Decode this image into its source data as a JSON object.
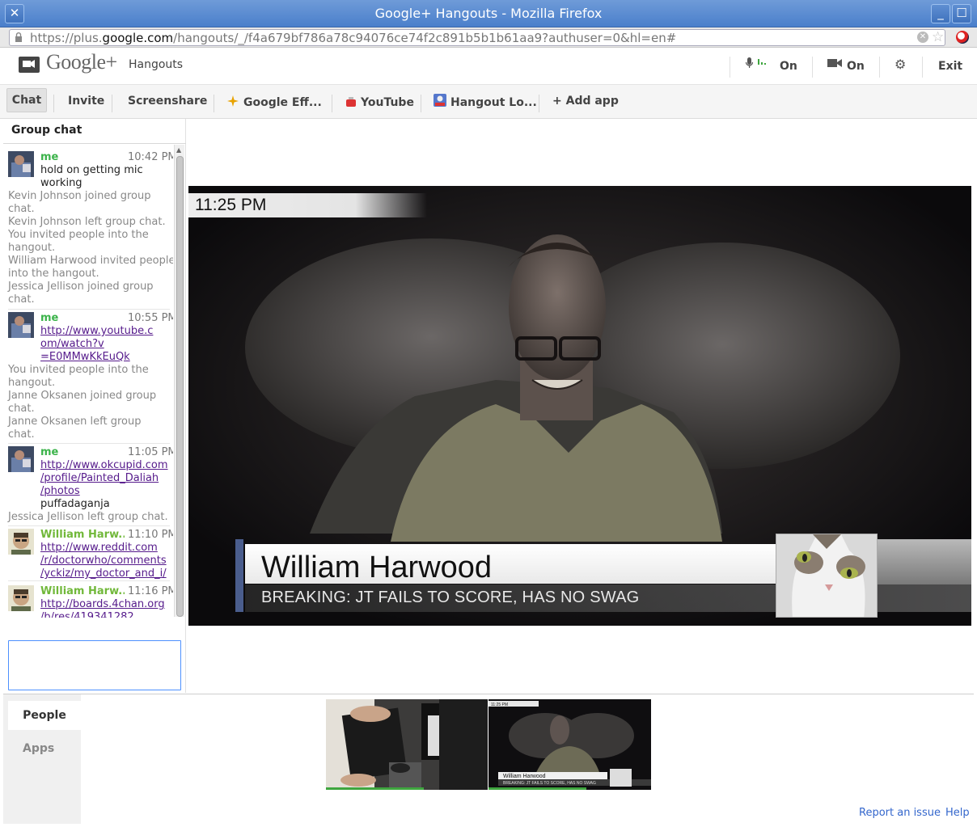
{
  "window": {
    "title": "Google+ Hangouts - Mozilla Firefox"
  },
  "address_bar": {
    "url_prefix": "https://plus.",
    "url_domain": "google.com",
    "url_path": "/hangouts/_/f4a679bf786a78c94076ce74f2c891b5b1b61aa9?authuser=0&hl=en#"
  },
  "header": {
    "brand": "Google+",
    "product": "Hangouts",
    "mic_status": "On",
    "camera_status": "On",
    "exit_label": "Exit"
  },
  "toolbar": {
    "chat": "Chat",
    "invite": "Invite",
    "screenshare": "Screenshare",
    "google_effects": "Google Eff...",
    "youtube": "YouTube",
    "hangout_lower_third": "Hangout Lo...",
    "add_app": "+ Add app"
  },
  "chat": {
    "title": "Group chat",
    "messages": [
      {
        "sender": "me",
        "time": "10:42 PM",
        "lines": [
          "hold on getting mic",
          "working"
        ]
      },
      {
        "system": [
          "Kevin Johnson joined group",
          "chat.",
          "Kevin Johnson left group chat.",
          "You invited people into the",
          "hangout.",
          "William Harwood invited people",
          "into the hangout.",
          "Jessica Jellison joined group",
          "chat."
        ]
      },
      {
        "sender": "me",
        "time": "10:55 PM",
        "links": [
          "http://www.youtube.c",
          "om/watch?v",
          "=E0MMwKkEuQk"
        ]
      },
      {
        "system": [
          "You invited people into the",
          "hangout.",
          "Janne Oksanen joined group",
          "chat.",
          "Janne Oksanen left group",
          "chat."
        ]
      },
      {
        "sender": "me",
        "time": "11:05 PM",
        "links": [
          "http://www.okcupid.com",
          "/profile/Painted_Daliah",
          "/photos"
        ],
        "lines": [
          "puffadaganja"
        ]
      },
      {
        "system": [
          "Jessica Jellison left group chat."
        ]
      },
      {
        "sender": "William Harw...",
        "time": "11:10 PM",
        "links": [
          "http://www.reddit.com",
          "/r/doctorwho/comments",
          "/yckiz/my_doctor_and_i/"
        ]
      },
      {
        "sender": "William Harw...",
        "time": "11:16 PM",
        "links": [
          "http://boards.4chan.org",
          "/b/res/419341282"
        ]
      }
    ],
    "input_value": ""
  },
  "video": {
    "timestamp": "11:25 PM",
    "lower_third_name": "William Harwood",
    "lower_third_headline": "BREAKING: JT FAILS TO SCORE, HAS NO SWAG"
  },
  "bottom": {
    "tab_people": "People",
    "tab_apps": "Apps",
    "thumb2_name": "William Harwood",
    "thumb2_headline": "BREAKING: JT FAILS TO SCORE, HAS NO SWAG",
    "thumb2_timestamp": "11:25 PM",
    "report_issue": "Report an issue",
    "help": "Help"
  },
  "colors": {
    "me_name": "#3bb34a",
    "william_name": "#71b83a",
    "link": "#551a8b",
    "footer_link": "#3366cc",
    "focus": "#4d90fe"
  }
}
